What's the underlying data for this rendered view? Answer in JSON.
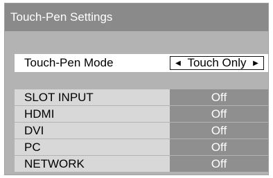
{
  "window": {
    "title": "Touch-Pen Settings"
  },
  "mode": {
    "label": "Touch-Pen Mode",
    "value": "Touch Only",
    "left_arrow": "◀",
    "right_arrow": "▶"
  },
  "inputs": [
    {
      "label": "SLOT INPUT",
      "value": "Off"
    },
    {
      "label": "HDMI",
      "value": "Off"
    },
    {
      "label": "DVI",
      "value": "Off"
    },
    {
      "label": "PC",
      "value": "Off"
    },
    {
      "label": "NETWORK",
      "value": "Off"
    }
  ],
  "icons": {
    "left": "arrow-left-icon",
    "right": "arrow-right-icon"
  },
  "colors": {
    "frame": "#b3b3b3",
    "title_bar": "#8a8a8a",
    "label_bg": "#d8d8d8",
    "value_bg": "#8f8f8f",
    "highlight": "#ffffff"
  }
}
